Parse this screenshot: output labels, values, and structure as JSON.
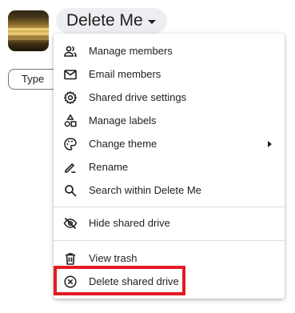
{
  "header": {
    "drive_name": "Delete Me",
    "thumbnail_icon": "drive-thumbnail",
    "dropdown_icon": "caret-down-icon"
  },
  "filters": {
    "type_label": "Type"
  },
  "menu": {
    "items": [
      {
        "label": "Manage members",
        "icon": "people-icon"
      },
      {
        "label": "Email members",
        "icon": "mail-icon"
      },
      {
        "label": "Shared drive settings",
        "icon": "gear-icon"
      },
      {
        "label": "Manage labels",
        "icon": "shapes-icon"
      },
      {
        "label": "Change theme",
        "icon": "palette-icon",
        "has_submenu": true
      },
      {
        "label": "Rename",
        "icon": "pencil-icon"
      },
      {
        "label": "Search within Delete Me",
        "icon": "search-icon"
      },
      {
        "label": "Hide shared drive",
        "icon": "eye-off-icon"
      },
      {
        "label": "View trash",
        "icon": "trash-icon"
      },
      {
        "label": "Delete shared drive",
        "icon": "circle-x-icon",
        "highlighted": true
      }
    ]
  },
  "colors": {
    "highlight": "#e31b23",
    "chip_background": "#eceef1",
    "text": "#1f1f1f"
  }
}
